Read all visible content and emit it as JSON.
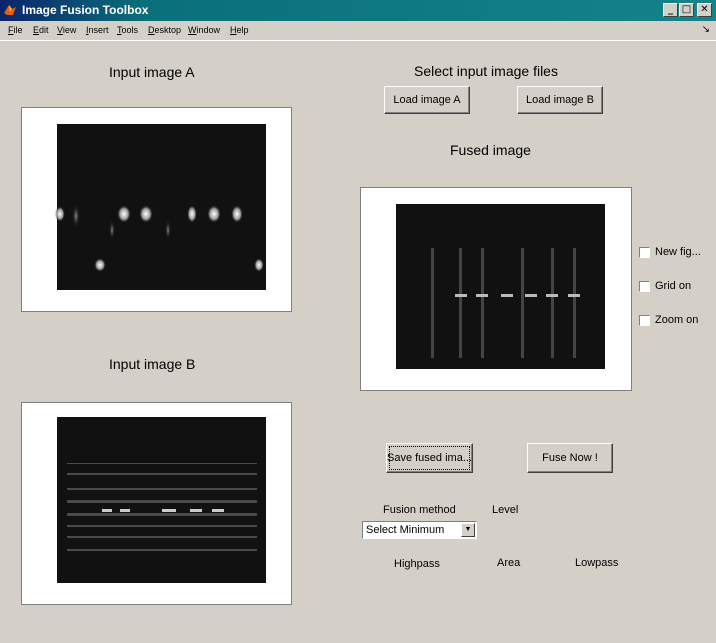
{
  "window": {
    "title": "Image Fusion Toolbox",
    "minimize_glyph": "_",
    "maximize_glyph": "□",
    "close_glyph": "✕"
  },
  "menu": [
    {
      "label": "File"
    },
    {
      "label": "Edit"
    },
    {
      "label": "View"
    },
    {
      "label": "Insert"
    },
    {
      "label": "Tools"
    },
    {
      "label": "Desktop"
    },
    {
      "label": "Window"
    },
    {
      "label": "Help"
    }
  ],
  "menu_corner_glyph": "↘",
  "panels": {
    "input_a_title": "Input image A",
    "input_b_title": "Input image B",
    "select_files_title": "Select input image files",
    "fused_title": "Fused image"
  },
  "buttons": {
    "load_a": "Load image A",
    "load_b": "Load image B",
    "save_fused": "Save fused ima...",
    "fuse_now": "Fuse Now !"
  },
  "checkboxes": [
    {
      "label": "New fig...",
      "checked": false
    },
    {
      "label": "Grid on",
      "checked": false
    },
    {
      "label": "Zoom on",
      "checked": false
    }
  ],
  "fusion": {
    "method_label": "Fusion method",
    "level_label": "Level",
    "method_selected": "Select Minimum",
    "highpass_label": "Highpass",
    "area_label": "Area",
    "lowpass_label": "Lowpass"
  },
  "colors": {
    "title_bar_start": "#0a246a",
    "title_bar_end": "#14848a",
    "window_bg": "#d4d0c8",
    "plot_bg": "#101010"
  }
}
